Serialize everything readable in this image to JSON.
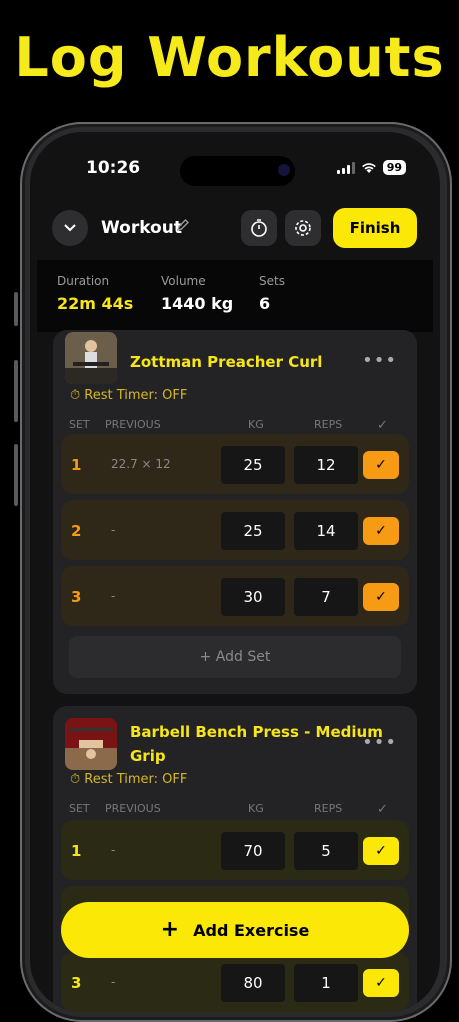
{
  "headline": "Log Workouts",
  "status": {
    "time": "10:26",
    "battery": "99"
  },
  "header": {
    "title": "Workout",
    "finish_label": "Finish"
  },
  "stats": {
    "duration_label": "Duration",
    "duration_value": "22m 44s",
    "volume_label": "Volume",
    "volume_value": "1440 kg",
    "sets_label": "Sets",
    "sets_value": "6"
  },
  "columns": {
    "set": "SET",
    "previous": "PREVIOUS",
    "kg": "KG",
    "reps": "REPS"
  },
  "exercises": [
    {
      "title": "Zottman Preacher Curl",
      "rest_timer": "Rest Timer: OFF",
      "sets": [
        {
          "num": "1",
          "previous": "22.7 × 12",
          "kg": "25",
          "reps": "12"
        },
        {
          "num": "2",
          "previous": "-",
          "kg": "25",
          "reps": "14"
        },
        {
          "num": "3",
          "previous": "-",
          "kg": "30",
          "reps": "7"
        }
      ],
      "add_set": "+ Add Set"
    },
    {
      "title_line1": "Barbell Bench Press - Medium",
      "title_line2": "Grip",
      "rest_timer": "Rest Timer: OFF",
      "sets": [
        {
          "num": "1",
          "previous": "-",
          "kg": "70",
          "reps": "5"
        },
        {
          "num": "3",
          "previous": "-",
          "kg": "80",
          "reps": "1"
        }
      ]
    }
  ],
  "add_exercise": "Add Exercise",
  "colors": {
    "accent": "#fbe806",
    "orange": "#f79a14",
    "card": "#232325"
  }
}
